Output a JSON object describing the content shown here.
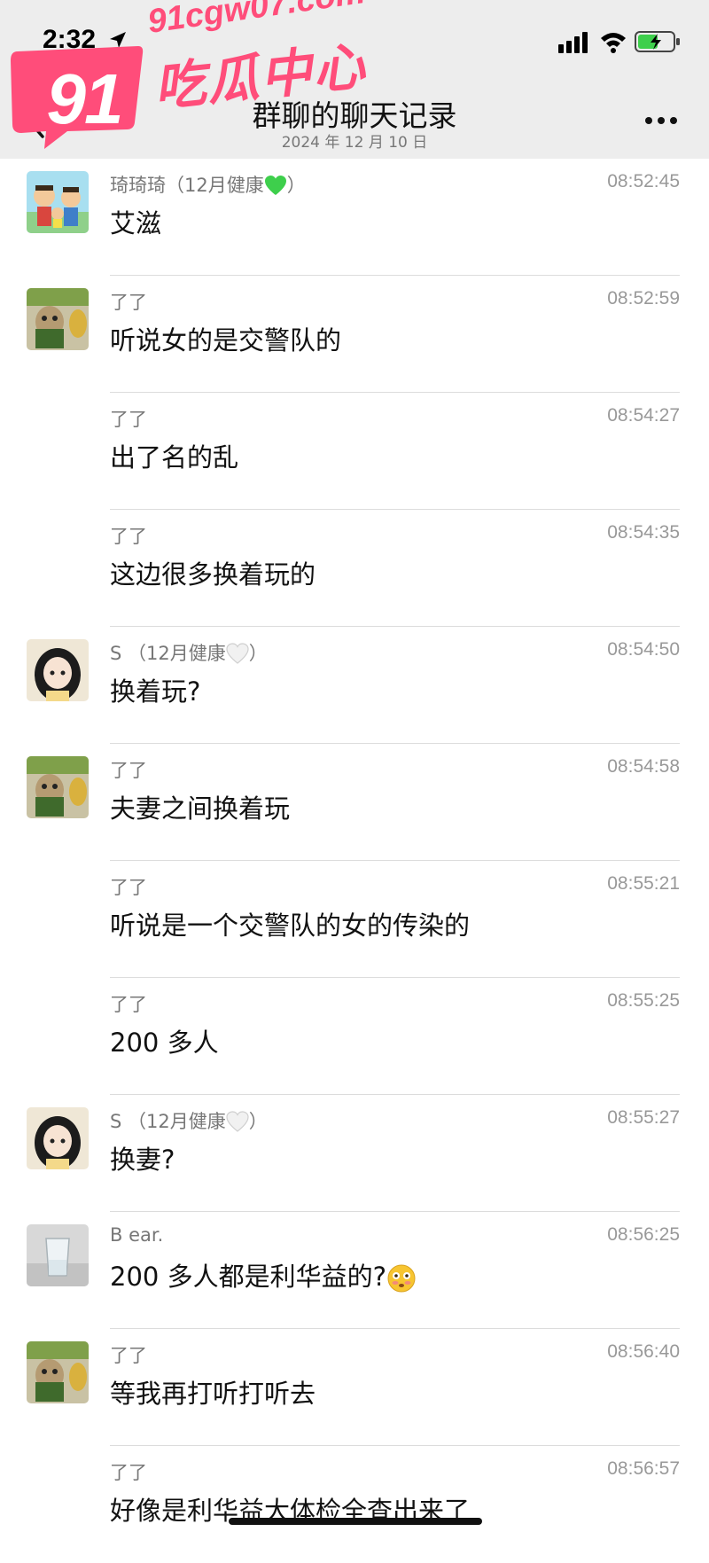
{
  "status_bar": {
    "time": "2:32"
  },
  "nav": {
    "title": "群聊的聊天记录",
    "date": "2024 年 12 月 10 日"
  },
  "watermark": {
    "number": "91",
    "url": "91cgw07.com",
    "text": "吃瓜中心"
  },
  "messages": [
    {
      "sender": "琦琦琦（12月健康",
      "sender_suffix": "）",
      "status_icon": "green-heart-icon",
      "time": "08:52:45",
      "text": "艾滋",
      "avatar": "cartoon-family-avatar",
      "show_avatar": true
    },
    {
      "sender": "了了",
      "time": "08:52:59",
      "text": "听说女的是交警队的",
      "avatar": "dog-toy-avatar",
      "show_avatar": true
    },
    {
      "sender": "了了",
      "time": "08:54:27",
      "text": "出了名的乱",
      "show_avatar": false
    },
    {
      "sender": "了了",
      "time": "08:54:35",
      "text": "这边很多换着玩的",
      "show_avatar": false
    },
    {
      "sender": "S （12月健康",
      "sender_suffix": "）",
      "status_icon": "white-heart-icon",
      "time": "08:54:50",
      "text": "换着玩?",
      "avatar": "anime-girl-avatar",
      "show_avatar": true
    },
    {
      "sender": "了了",
      "time": "08:54:58",
      "text": "夫妻之间换着玩",
      "avatar": "dog-toy-avatar",
      "show_avatar": true
    },
    {
      "sender": "了了",
      "time": "08:55:21",
      "text": "听说是一个交警队的女的传染的",
      "show_avatar": false
    },
    {
      "sender": "了了",
      "time": "08:55:25",
      "text": "200 多人",
      "show_avatar": false
    },
    {
      "sender": "S （12月健康",
      "sender_suffix": "）",
      "status_icon": "white-heart-icon",
      "time": "08:55:27",
      "text": "换妻?",
      "avatar": "anime-girl-avatar",
      "show_avatar": true
    },
    {
      "sender": "B ear.",
      "time": "08:56:25",
      "text": "200 多人都是利华益的?",
      "text_icon": "flushed-face-emoji",
      "avatar": "glass-cup-avatar",
      "show_avatar": true
    },
    {
      "sender": "了了",
      "time": "08:56:40",
      "text": "等我再打听打听去",
      "avatar": "dog-toy-avatar",
      "show_avatar": true
    },
    {
      "sender": "了了",
      "time": "08:56:57",
      "text": "好像是利华益大体检全查出来了",
      "show_avatar": false
    }
  ]
}
